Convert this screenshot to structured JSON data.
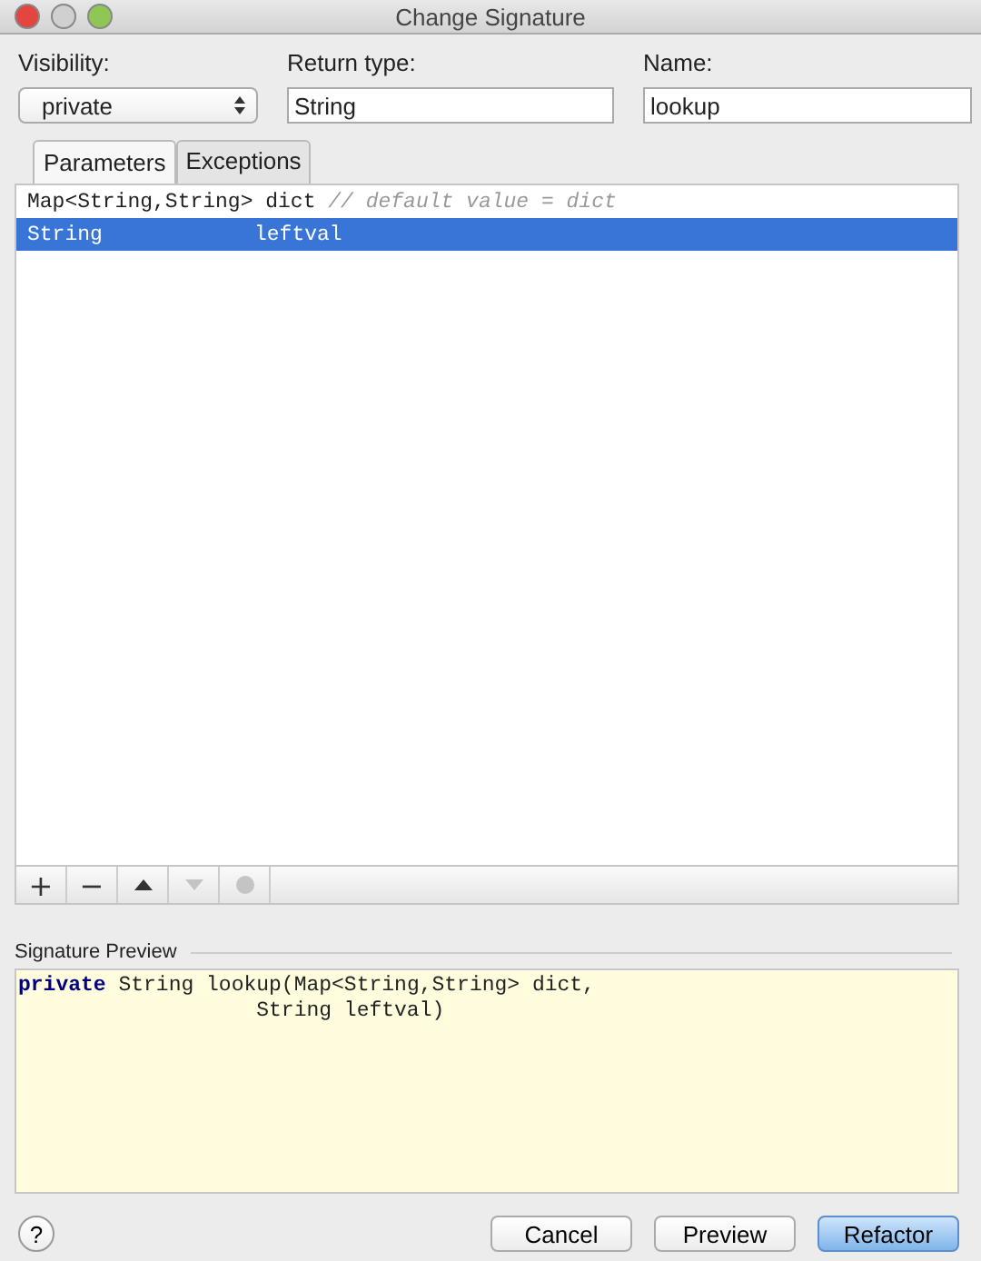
{
  "window": {
    "title": "Change Signature"
  },
  "fields": {
    "visibility": {
      "label": "Visibility:",
      "value": "private"
    },
    "return_type": {
      "label": "Return type:",
      "value": "String"
    },
    "name": {
      "label": "Name:",
      "value": "lookup"
    }
  },
  "tabs": [
    {
      "label": "Parameters",
      "selected": true
    },
    {
      "label": "Exceptions",
      "selected": false
    }
  ],
  "parameters": [
    {
      "kind": "editing",
      "type": "Map<String,String>",
      "name": "dict",
      "comment": "// default value = dict",
      "selected": false
    },
    {
      "kind": "plain",
      "type": "String",
      "name": "leftval",
      "selected": true
    }
  ],
  "toolbar": [
    {
      "kind": "add",
      "label": "+",
      "disabled": false
    },
    {
      "kind": "remove",
      "label": "−",
      "disabled": false
    },
    {
      "kind": "up",
      "disabled": false
    },
    {
      "kind": "down",
      "disabled": true
    },
    {
      "kind": "circle",
      "disabled": true
    }
  ],
  "preview": {
    "title": "Signature Preview",
    "lines": [
      "**private** String lookup(Map<String,String> dict,",
      "                   String leftval)"
    ]
  },
  "help": "?",
  "buttons": [
    {
      "label": "Cancel",
      "default": false
    },
    {
      "label": "Preview",
      "default": false
    },
    {
      "label": "Refactor",
      "default": true
    }
  ]
}
